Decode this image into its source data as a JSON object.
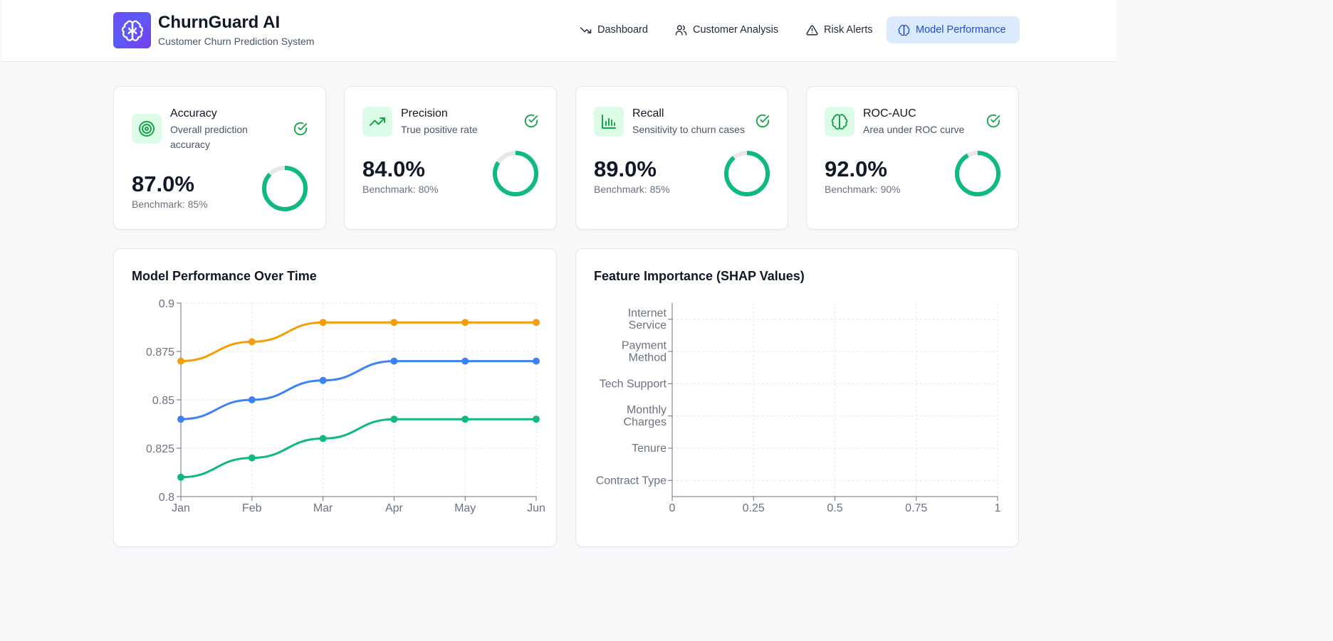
{
  "header": {
    "brand_title": "ChurnGuard AI",
    "brand_subtitle": "Customer Churn Prediction System",
    "nav": [
      {
        "label": "Dashboard",
        "icon": "trend-down-icon",
        "active": false
      },
      {
        "label": "Customer Analysis",
        "icon": "users-icon",
        "active": false
      },
      {
        "label": "Risk Alerts",
        "icon": "alert-triangle-icon",
        "active": false
      },
      {
        "label": "Model Performance",
        "icon": "brain-icon",
        "active": true
      }
    ]
  },
  "metrics": [
    {
      "title": "Accuracy",
      "description": "Overall prediction accuracy",
      "value": "87.0%",
      "benchmark": "Benchmark: 85%",
      "progress": 0.87,
      "icon": "target-icon"
    },
    {
      "title": "Precision",
      "description": "True positive rate",
      "value": "84.0%",
      "benchmark": "Benchmark: 80%",
      "progress": 0.84,
      "icon": "trending-up-icon"
    },
    {
      "title": "Recall",
      "description": "Sensitivity to churn cases",
      "value": "89.0%",
      "benchmark": "Benchmark: 85%",
      "progress": 0.89,
      "icon": "bar-chart-icon"
    },
    {
      "title": "ROC-AUC",
      "description": "Area under ROC curve",
      "value": "92.0%",
      "benchmark": "Benchmark: 90%",
      "progress": 0.92,
      "icon": "brain-icon"
    }
  ],
  "colors": {
    "accent": "#1d4ed8",
    "success": "#10b981",
    "orange": "#f59e0b",
    "blue": "#3b82f6",
    "green": "#10b981"
  },
  "performance_chart": {
    "title": "Model Performance Over Time"
  },
  "feature_chart": {
    "title": "Feature Importance (SHAP Values)"
  },
  "chart_data": [
    {
      "type": "line",
      "title": "Model Performance Over Time",
      "categories": [
        "Jan",
        "Feb",
        "Mar",
        "Apr",
        "May",
        "Jun"
      ],
      "yticks": [
        "0.8",
        "0.825",
        "0.85",
        "0.875",
        "0.9"
      ],
      "ylim": [
        0.8,
        0.9
      ],
      "grid": true,
      "series": [
        {
          "color": "#f59e0b",
          "values": [
            0.87,
            0.88,
            0.89,
            0.89,
            0.89,
            0.89
          ]
        },
        {
          "color": "#3b82f6",
          "values": [
            0.84,
            0.85,
            0.86,
            0.87,
            0.87,
            0.87
          ]
        },
        {
          "color": "#10b981",
          "values": [
            0.81,
            0.82,
            0.83,
            0.84,
            0.84,
            0.84
          ]
        }
      ]
    },
    {
      "type": "bar",
      "orientation": "horizontal",
      "title": "Feature Importance (SHAP Values)",
      "categories": [
        [
          "Internet",
          "Service"
        ],
        [
          "Payment",
          "Method"
        ],
        [
          "Tech Support"
        ],
        [
          "Monthly",
          "Charges"
        ],
        [
          "Tenure"
        ],
        [
          "Contract Type"
        ]
      ],
      "xticks": [
        "0",
        "0.25",
        "0.5",
        "0.75",
        "1"
      ],
      "xlim": [
        0,
        1
      ],
      "grid": true,
      "values": []
    }
  ]
}
